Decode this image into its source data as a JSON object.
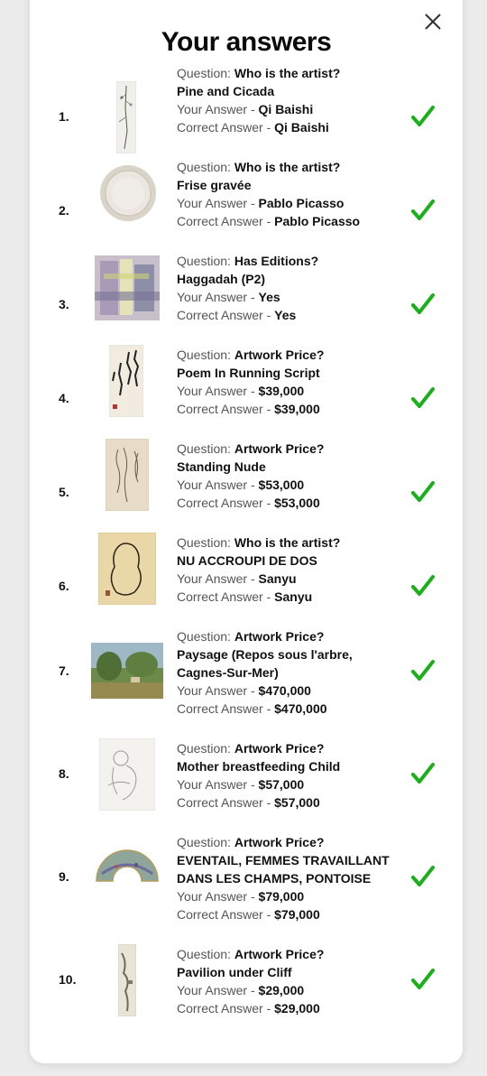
{
  "title": "Your answers",
  "labels": {
    "question": "Question:",
    "your_answer": "Your Answer -",
    "correct_answer": "Correct Answer -"
  },
  "check_color": "#19b019",
  "answers": [
    {
      "num": "1.",
      "question": "Who is the artist?",
      "artwork": "Pine and Cicada",
      "your_answer": "Qi Baishi",
      "correct_answer": "Qi Baishi",
      "thumb": "scroll-painting"
    },
    {
      "num": "2.",
      "question": "Who is the artist?",
      "artwork": "Frise gravée",
      "your_answer": "Pablo Picasso",
      "correct_answer": "Pablo Picasso",
      "thumb": "ceramic-plate"
    },
    {
      "num": "3.",
      "question": "Has Editions?",
      "artwork": "Haggadah (P2)",
      "your_answer": "Yes",
      "correct_answer": "Yes",
      "thumb": "abstract-print"
    },
    {
      "num": "4.",
      "question": "Artwork Price?",
      "artwork": "Poem In Running Script",
      "your_answer": "$39,000",
      "correct_answer": "$39,000",
      "thumb": "calligraphy"
    },
    {
      "num": "5.",
      "question": "Artwork Price?",
      "artwork": "Standing Nude",
      "your_answer": "$53,000",
      "correct_answer": "$53,000",
      "thumb": "figure-drawing"
    },
    {
      "num": "6.",
      "question": "Who is the artist?",
      "artwork": "NU ACCROUPI DE DOS",
      "your_answer": "Sanyu",
      "correct_answer": "Sanyu",
      "thumb": "ink-nude"
    },
    {
      "num": "7.",
      "question": "Artwork Price?",
      "artwork_line1": "Paysage (Repos sous l'arbre,",
      "artwork_line2": "Cagnes-Sur-Mer)",
      "your_answer": "$470,000",
      "correct_answer": "$470,000",
      "thumb": "landscape-painting"
    },
    {
      "num": "8.",
      "question": "Artwork Price?",
      "artwork": "Mother breastfeeding Child",
      "your_answer": "$57,000",
      "correct_answer": "$57,000",
      "thumb": "pencil-sketch"
    },
    {
      "num": "9.",
      "question": "Artwork Price?",
      "artwork_line1": "EVENTAIL, FEMMES TRAVAILLANT",
      "artwork_line2": "DANS LES CHAMPS, PONTOISE",
      "your_answer": "$79,000",
      "correct_answer": "$79,000",
      "thumb": "fan-painting"
    },
    {
      "num": "10.",
      "question": "Artwork Price?",
      "artwork": "Pavilion under Cliff",
      "your_answer": "$29,000",
      "correct_answer": "$29,000",
      "thumb": "scroll-landscape"
    }
  ]
}
